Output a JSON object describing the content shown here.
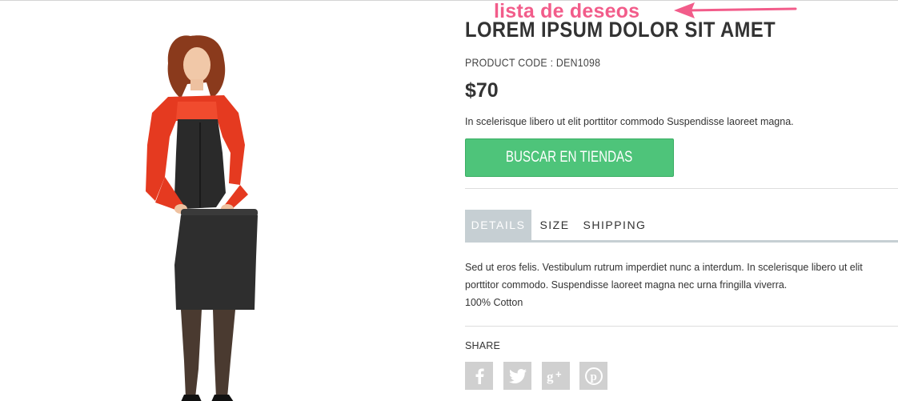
{
  "annotation": {
    "text": "lista de deseos",
    "color": "#f25c8a"
  },
  "product": {
    "title": "LOREM IPSUM DOLOR SIT AMET",
    "code": "PRODUCT CODE : DEN1098",
    "price": "$70",
    "short_description": "In scelerisque libero ut elit porttitor commodo Suspendisse laoreet magna.",
    "image_icon": "model-photo"
  },
  "buy_button": {
    "label": "BUSCAR EN TIENDAS",
    "color": "#4ec47a"
  },
  "tabs": [
    {
      "label": "DETAILS",
      "active": true
    },
    {
      "label": "SIZE",
      "active": false
    },
    {
      "label": "SHIPPING",
      "active": false
    }
  ],
  "details_content": {
    "line1": "Sed ut eros felis. Vestibulum rutrum imperdiet nunc a interdum. In scelerisque libero ut elit",
    "line2": "porttitor commodo. Suspendisse laoreet magna nec urna fringilla viverra.",
    "line3": "100% Cotton"
  },
  "share": {
    "label": "SHARE",
    "icons": [
      "facebook-icon",
      "twitter-icon",
      "google-plus-icon",
      "pinterest-icon"
    ]
  }
}
